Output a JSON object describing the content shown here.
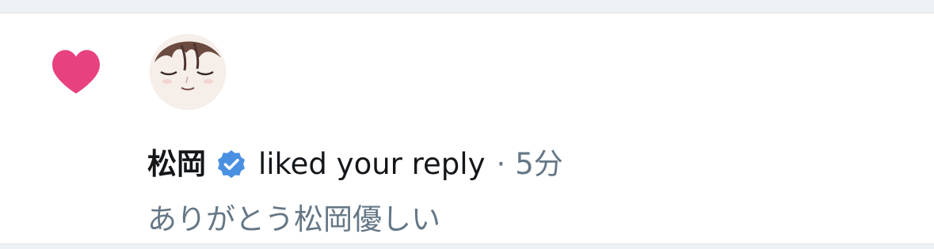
{
  "notification": {
    "icon": "heart-icon",
    "avatar": "avatar",
    "username": "松岡",
    "verified_icon": "verified-badge-icon",
    "action": "liked your reply",
    "separator": "·",
    "time": "5分",
    "reply_text": "ありがとう松岡優しい"
  },
  "colors": {
    "heart": "#e0245e",
    "verified": "#1da1f2",
    "primary_text": "#14171a",
    "secondary_text": "#657786",
    "background_strip": "#eef1f3"
  }
}
